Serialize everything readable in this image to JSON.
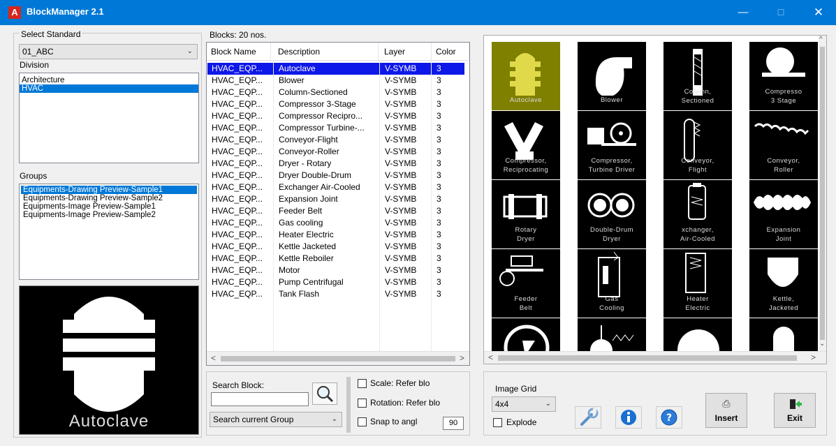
{
  "window": {
    "title": "BlockManager 2.1",
    "minimize": "—",
    "maximize": "☐",
    "close": "✕"
  },
  "left": {
    "standard_label": "Select Standard",
    "standard_value": "01_ABC",
    "division_label": "Division",
    "divisions": [
      "Architecture",
      "HVAC"
    ],
    "groups_label": "Groups",
    "groups": [
      "Equipments-Drawing Preview-Sample1",
      "Equipments-Drawing Preview-Sample2",
      "Equipments-Image Preview-Sample1",
      "Equipments-Image Preview-Sample2"
    ],
    "preview_caption": "Autoclave"
  },
  "blocks": {
    "count_label": "Blocks: 20 nos.",
    "columns": [
      "Block Name",
      "Description",
      "Layer",
      "Color"
    ],
    "rows": [
      [
        "HVAC_EQP...",
        "Autoclave",
        "V-SYMB",
        "3"
      ],
      [
        "HVAC_EQP...",
        "Blower",
        "V-SYMB",
        "3"
      ],
      [
        "HVAC_EQP...",
        "Column-Sectioned",
        "V-SYMB",
        "3"
      ],
      [
        "HVAC_EQP...",
        "Compressor 3-Stage",
        "V-SYMB",
        "3"
      ],
      [
        "HVAC_EQP...",
        "Compressor Recipro...",
        "V-SYMB",
        "3"
      ],
      [
        "HVAC_EQP...",
        "Compressor Turbine-...",
        "V-SYMB",
        "3"
      ],
      [
        "HVAC_EQP...",
        "Conveyor-Flight",
        "V-SYMB",
        "3"
      ],
      [
        "HVAC_EQP...",
        "Conveyor-Roller",
        "V-SYMB",
        "3"
      ],
      [
        "HVAC_EQP...",
        "Dryer - Rotary",
        "V-SYMB",
        "3"
      ],
      [
        "HVAC_EQP...",
        "Dryer Double-Drum",
        "V-SYMB",
        "3"
      ],
      [
        "HVAC_EQP...",
        "Exchanger Air-Cooled",
        "V-SYMB",
        "3"
      ],
      [
        "HVAC_EQP...",
        "Expansion Joint",
        "V-SYMB",
        "3"
      ],
      [
        "HVAC_EQP...",
        "Feeder Belt",
        "V-SYMB",
        "3"
      ],
      [
        "HVAC_EQP...",
        "Gas cooling",
        "V-SYMB",
        "3"
      ],
      [
        "HVAC_EQP...",
        "Heater Electric",
        "V-SYMB",
        "3"
      ],
      [
        "HVAC_EQP...",
        "Kettle Jacketed",
        "V-SYMB",
        "3"
      ],
      [
        "HVAC_EQP...",
        "Kettle Reboiler",
        "V-SYMB",
        "3"
      ],
      [
        "HVAC_EQP...",
        "Motor",
        "V-SYMB",
        "3"
      ],
      [
        "HVAC_EQP...",
        "Pump Centrifugal",
        "V-SYMB",
        "3"
      ],
      [
        "HVAC_EQP...",
        "Tank Flash",
        "V-SYMB",
        "3"
      ]
    ]
  },
  "search": {
    "label": "Search Block:",
    "value": "",
    "scope": "Search current Group",
    "scale_label": "Scale:  Refer blo",
    "rotation_label": "Rotation:  Refer blo",
    "snap_label": "Snap to angl",
    "snap_value": "90"
  },
  "grid": {
    "captions": [
      [
        "Autoclave"
      ],
      [
        "Blower"
      ],
      [
        "Column,",
        "Sectioned"
      ],
      [
        "Compresso",
        "3 Stage"
      ],
      [
        "Compressor,",
        "Reciprocating"
      ],
      [
        "Compressor,",
        "Turbine Driver"
      ],
      [
        "Conveyor,",
        "Flight"
      ],
      [
        "Conveyor,",
        "Roller"
      ],
      [
        "Rotary",
        "Dryer"
      ],
      [
        "Double-Drum",
        "Dryer"
      ],
      [
        "xchanger,",
        "Air-Cooled"
      ],
      [
        "Expansion",
        "Joint"
      ],
      [
        "Feeder",
        "Belt"
      ],
      [
        "Gas",
        "Cooling"
      ],
      [
        "Heater",
        "Electric"
      ],
      [
        "Kettle,",
        "Jacketed"
      ]
    ]
  },
  "bottom": {
    "image_grid_label": "Image Grid",
    "image_grid_value": "4x4",
    "explode_label": "Explode",
    "insert_label": "Insert",
    "exit_label": "Exit"
  },
  "colors": {
    "title_bar": "#0078d7",
    "selection": "#0078d7",
    "row_selection": "#0e18e8",
    "thumb_selected": "#7f7f00"
  }
}
